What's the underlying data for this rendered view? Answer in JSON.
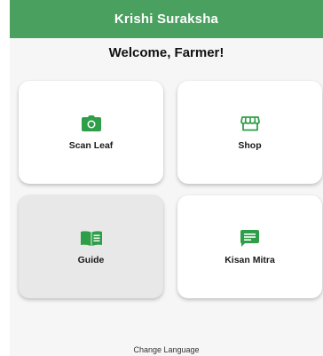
{
  "app": {
    "title": "Krishi Suraksha",
    "accent_color": "#4aa05f",
    "icon_color": "#2e9e48"
  },
  "welcome": {
    "text": "Welcome, Farmer!"
  },
  "cards": [
    {
      "label": "Scan Leaf",
      "icon": "camera-icon"
    },
    {
      "label": "Shop",
      "icon": "shop-icon"
    },
    {
      "label": "Guide",
      "icon": "book-icon",
      "state": "pressed"
    },
    {
      "label": "Kisan Mitra",
      "icon": "chat-icon"
    }
  ],
  "footer": {
    "change_language": "Change Language"
  }
}
